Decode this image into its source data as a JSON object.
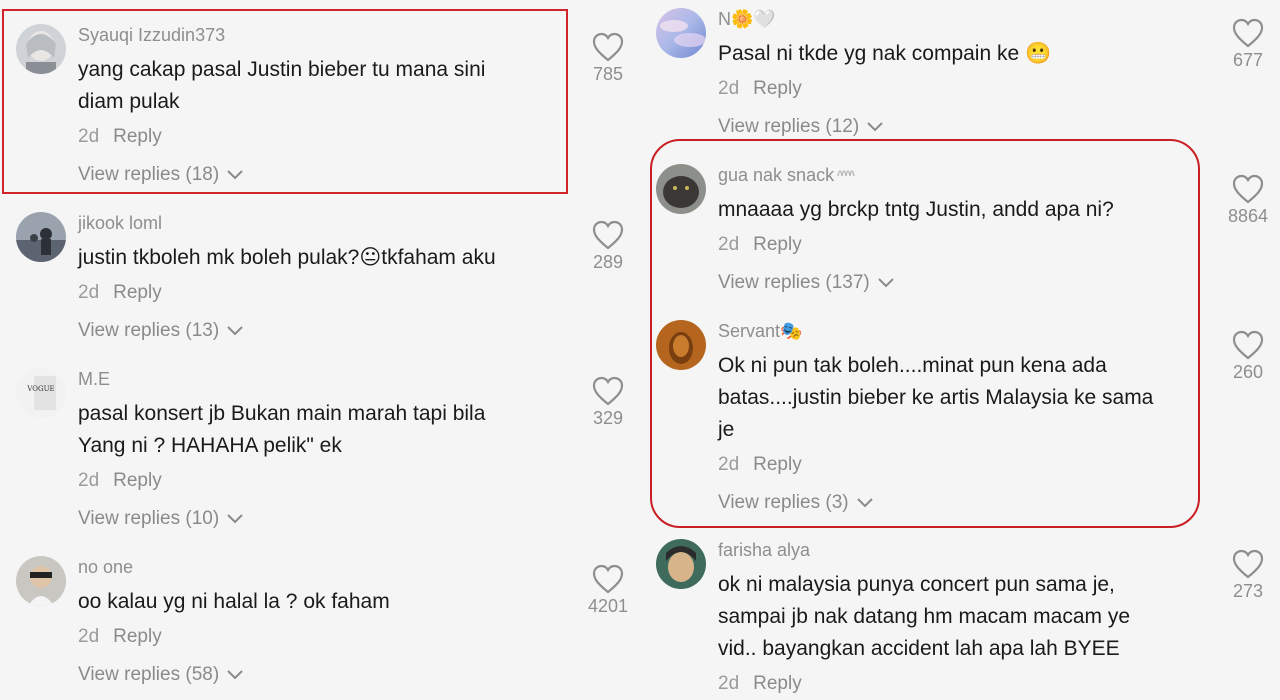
{
  "left": [
    {
      "username": "Syauqi Izzudin373",
      "text": "yang cakap pasal Justin bieber tu mana sini\ndiam pulak",
      "time": "2d",
      "reply": "Reply",
      "view_replies": "View replies (18)",
      "likes": "785"
    },
    {
      "username": "jikook loml",
      "text": "justin tkboleh mk boleh pulak?😐tkfaham aku",
      "time": "2d",
      "reply": "Reply",
      "view_replies": "View replies (13)",
      "likes": "289"
    },
    {
      "username": "M.E",
      "text": "pasal konsert jb Bukan main marah tapi bila\nYang ni ? HAHAHA pelik\" ek",
      "time": "2d",
      "reply": "Reply",
      "view_replies": "View replies (10)",
      "likes": "329"
    },
    {
      "username": "no one",
      "text": "oo kalau yg ni halal la ? ok faham",
      "time": "2d",
      "reply": "Reply",
      "view_replies": "View replies (58)",
      "likes": "4201"
    }
  ],
  "right": [
    {
      "username": "N🌼🤍",
      "text": "Pasal ni tkde yg nak compain ke 😬",
      "time": "2d",
      "reply": "Reply",
      "view_replies": "View replies (12)",
      "likes": "677"
    },
    {
      "username": "gua nak snack",
      "text": "mnaaaa yg brckp tntg Justin, andd apa ni?",
      "time": "2d",
      "reply": "Reply",
      "view_replies": "View replies (137)",
      "likes": "8864"
    },
    {
      "username": "Servant🎭",
      "text": "Ok ni pun tak boleh....minat pun kena ada\nbatas....justin bieber ke artis Malaysia ke sama\nje",
      "time": "2d",
      "reply": "Reply",
      "view_replies": "View replies (3)",
      "likes": "260"
    },
    {
      "username": "farisha alya",
      "text": "ok ni malaysia punya concert pun sama je,\nsampai jb nak datang hm macam macam ye\nvid.. bayangkan accident lah apa lah BYEE",
      "time": "2d",
      "reply": "Reply",
      "likes": "273"
    }
  ],
  "avatar_badge_text": "VOGUE",
  "colors": {
    "background": "#f5f5f5",
    "highlight": "#d0242a",
    "username": "#8e8e8e",
    "text": "#1a1a1a"
  }
}
